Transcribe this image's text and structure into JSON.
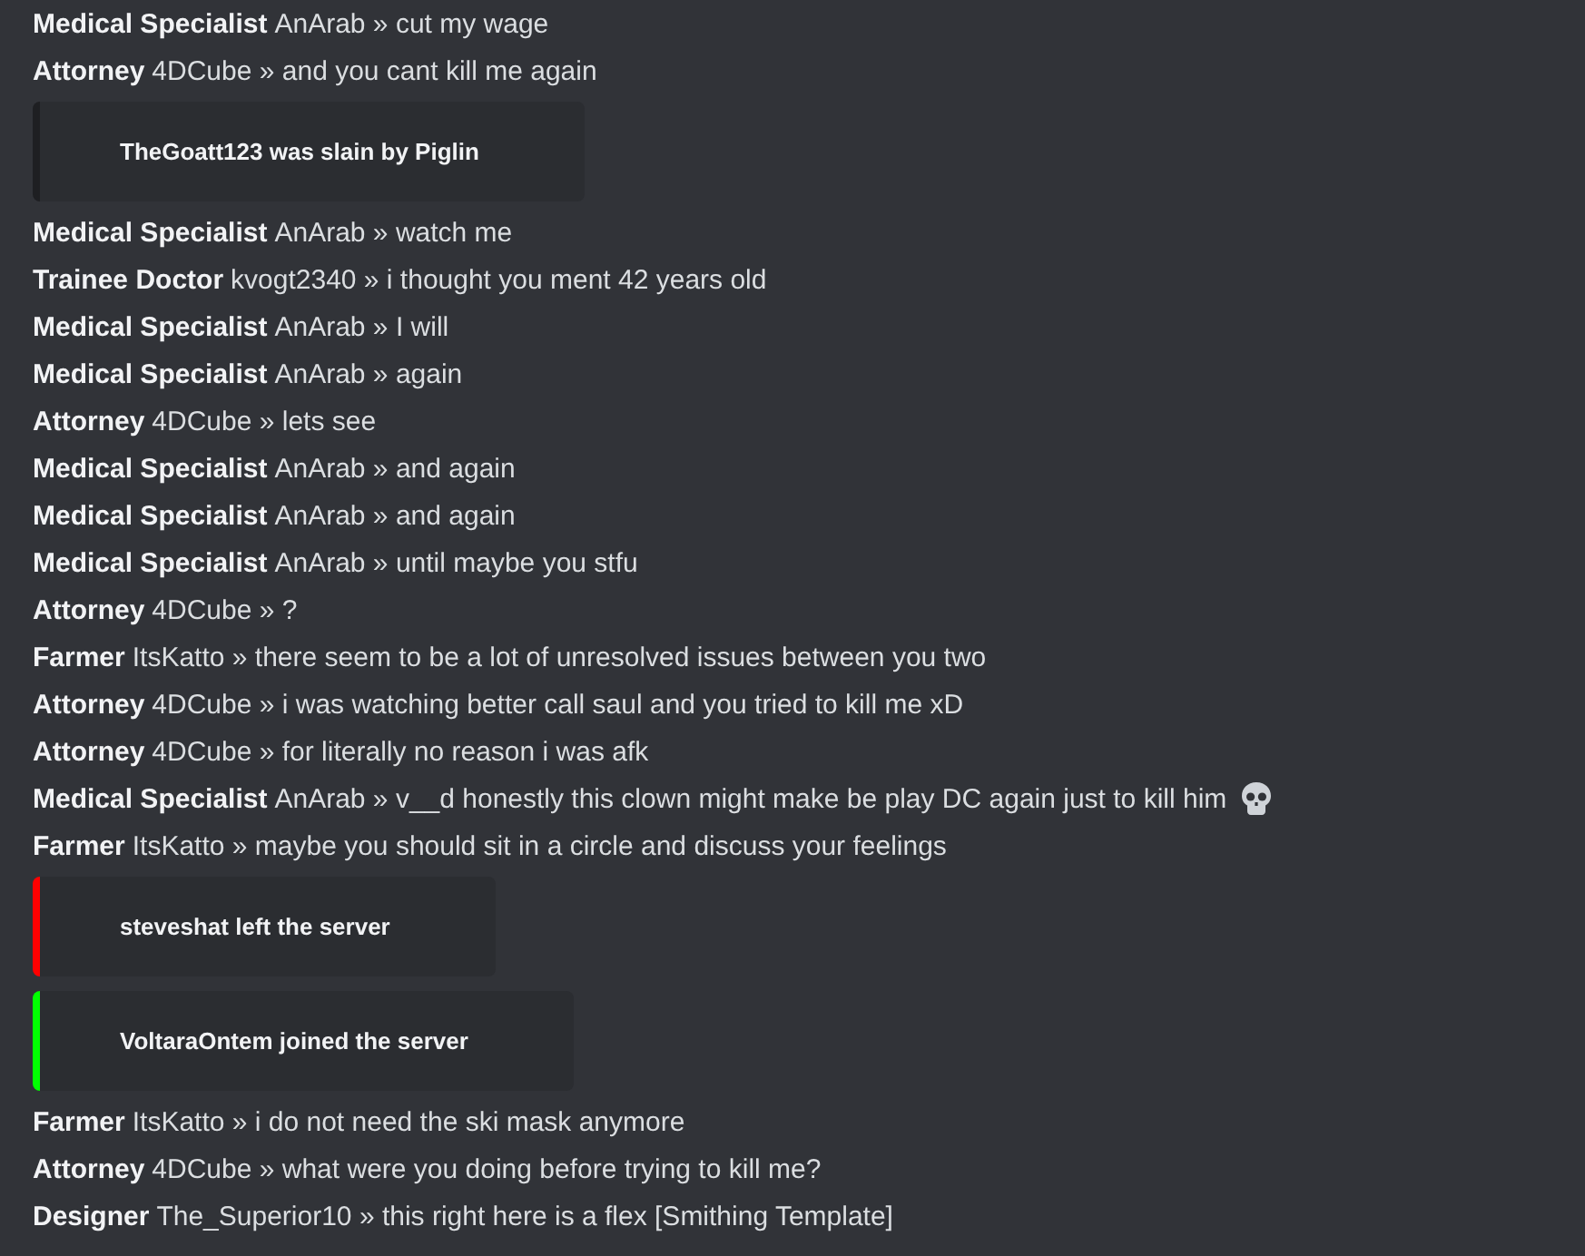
{
  "feed": [
    {
      "kind": "message",
      "role": "Medical Specialist",
      "user": "AnArab",
      "separator": "»",
      "text": "cut my wage"
    },
    {
      "kind": "message",
      "role": "Attorney",
      "user": "4DCube",
      "separator": "»",
      "text": "and you cant kill me again"
    },
    {
      "kind": "embed",
      "color": "#1e1f22",
      "text": "TheGoatt123 was slain by Piglin"
    },
    {
      "kind": "message",
      "role": "Medical Specialist",
      "user": "AnArab",
      "separator": "»",
      "text": "watch me"
    },
    {
      "kind": "message",
      "role": "Trainee Doctor",
      "user": "kvogt2340",
      "separator": "»",
      "text": "i thought you ment 42 years old"
    },
    {
      "kind": "message",
      "role": "Medical Specialist",
      "user": "AnArab",
      "separator": "»",
      "text": "I will"
    },
    {
      "kind": "message",
      "role": "Medical Specialist",
      "user": "AnArab",
      "separator": "»",
      "text": "again"
    },
    {
      "kind": "message",
      "role": "Attorney",
      "user": "4DCube",
      "separator": "»",
      "text": "lets see"
    },
    {
      "kind": "message",
      "role": "Medical Specialist",
      "user": "AnArab",
      "separator": "»",
      "text": "and again"
    },
    {
      "kind": "message",
      "role": "Medical Specialist",
      "user": "AnArab",
      "separator": "»",
      "text": "and again"
    },
    {
      "kind": "message",
      "role": "Medical Specialist",
      "user": "AnArab",
      "separator": "»",
      "text": "until maybe you stfu"
    },
    {
      "kind": "message",
      "role": "Attorney",
      "user": "4DCube",
      "separator": "»",
      "text": "?"
    },
    {
      "kind": "message",
      "role": "Farmer",
      "user": "ItsKatto",
      "separator": "»",
      "text": "there seem to be a lot of unresolved issues between you two"
    },
    {
      "kind": "message",
      "role": "Attorney",
      "user": "4DCube",
      "separator": "»",
      "text": "i was watching better call saul and you tried to kill me xD"
    },
    {
      "kind": "message",
      "role": "Attorney",
      "user": "4DCube",
      "separator": "»",
      "text": "for literally no reason i was afk"
    },
    {
      "kind": "message",
      "role": "Medical Specialist",
      "user": "AnArab",
      "separator": "»",
      "text": "v__d honestly this clown might make be play DC again just to kill him",
      "skull_emoji": true
    },
    {
      "kind": "message",
      "role": "Farmer",
      "user": "ItsKatto",
      "separator": "»",
      "text": "maybe you should sit in a circle and discuss your feelings"
    },
    {
      "kind": "embed",
      "color": "#ff0000",
      "text": "steveshat left the server"
    },
    {
      "kind": "embed",
      "color": "#00ff00",
      "text": "VoltaraOntem joined the server"
    },
    {
      "kind": "message",
      "role": "Farmer",
      "user": "ItsKatto",
      "separator": "»",
      "text": "i do not need the ski mask anymore"
    },
    {
      "kind": "message",
      "role": "Attorney",
      "user": "4DCube",
      "separator": "»",
      "text": "what were you doing before trying to kill me?"
    },
    {
      "kind": "message",
      "role": "Designer",
      "user": "The_Superior10",
      "separator": "»",
      "text": "this right here is a flex [Smithing Template]"
    }
  ]
}
